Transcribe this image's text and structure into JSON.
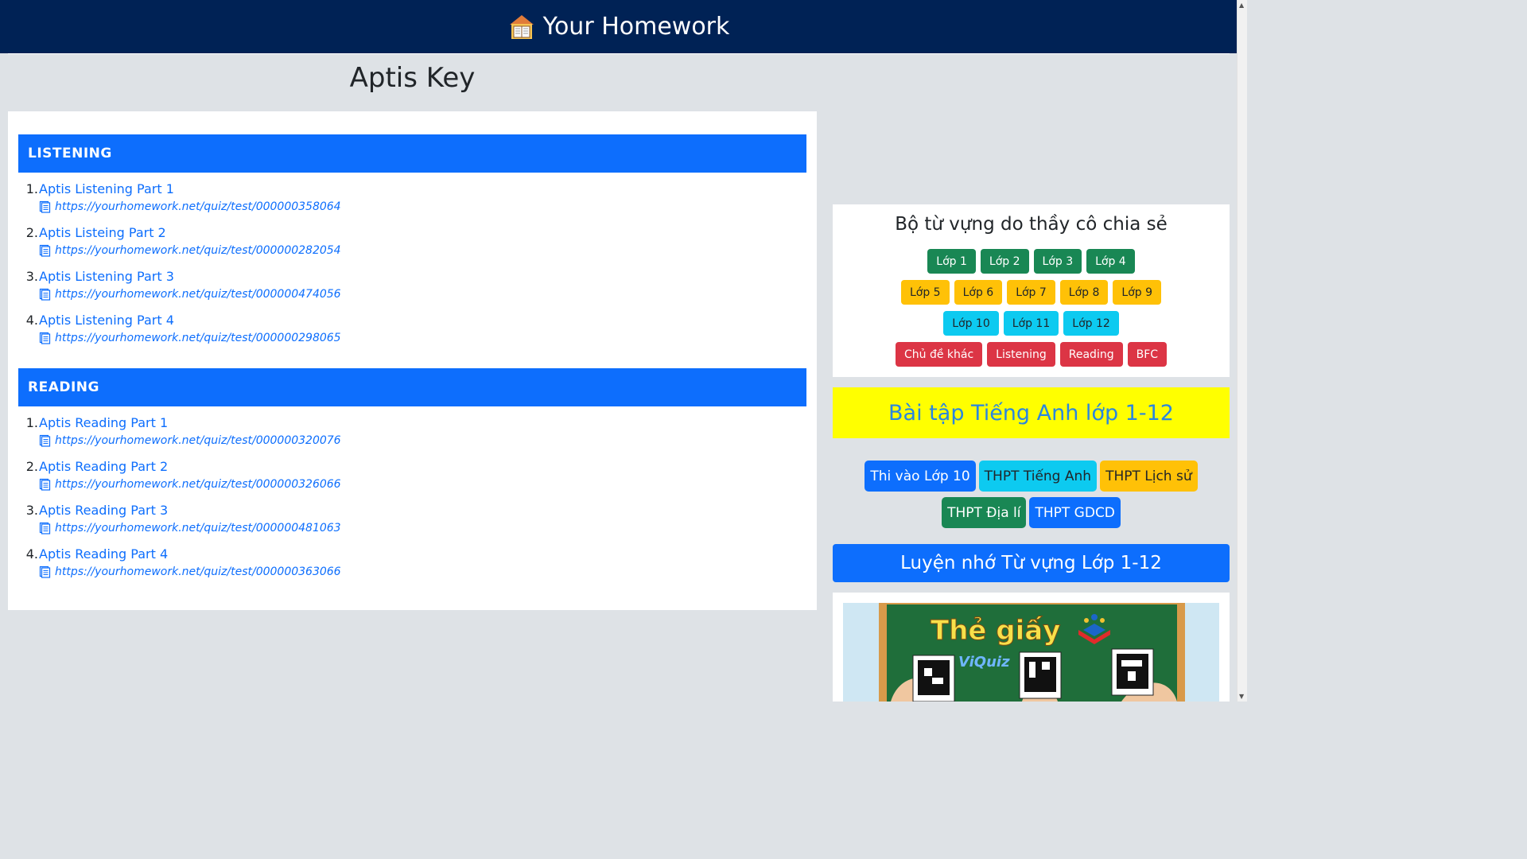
{
  "header": {
    "title": "Your Homework",
    "logo_icon": "house-book-icon"
  },
  "page": {
    "title": "Aptis Key"
  },
  "sections": [
    {
      "heading": "LISTENING",
      "items": [
        {
          "num": "1.",
          "title": "Aptis Listening Part 1",
          "url": "https://yourhomework.net/quiz/test/000000358064"
        },
        {
          "num": "2.",
          "title": "Aptis Listeing Part 2",
          "url": "https://yourhomework.net/quiz/test/000000282054"
        },
        {
          "num": "3.",
          "title": "Aptis Listening Part 3",
          "url": "https://yourhomework.net/quiz/test/000000474056"
        },
        {
          "num": "4.",
          "title": "Aptis Listening Part 4",
          "url": "https://yourhomework.net/quiz/test/000000298065"
        }
      ]
    },
    {
      "heading": "READING",
      "items": [
        {
          "num": "1.",
          "title": "Aptis Reading Part 1",
          "url": "https://yourhomework.net/quiz/test/000000320076"
        },
        {
          "num": "2.",
          "title": "Aptis Reading Part 2",
          "url": "https://yourhomework.net/quiz/test/000000326066"
        },
        {
          "num": "3.",
          "title": "Aptis Reading Part 3",
          "url": "https://yourhomework.net/quiz/test/000000481063"
        },
        {
          "num": "4.",
          "title": "Aptis Reading Part 4",
          "url": "https://yourhomework.net/quiz/test/000000363066"
        }
      ]
    }
  ],
  "vocab": {
    "title": "Bộ từ vựng do thầy cô chia sẻ",
    "rows": [
      [
        "Lớp 1",
        "Lớp 2",
        "Lớp 3",
        "Lớp 4"
      ],
      [
        "Lớp 5",
        "Lớp 6",
        "Lớp 7",
        "Lớp 8",
        "Lớp 9"
      ],
      [
        "Lớp 10",
        "Lớp 11",
        "Lớp 12"
      ],
      [
        "Chủ đề khác",
        "Listening",
        "Reading",
        "BFC"
      ]
    ]
  },
  "exercises_banner": "Bài tập Tiếng Anh lớp 1-12",
  "exam_buttons": {
    "row1": [
      "Thi vào Lớp 10",
      "THPT Tiếng Anh",
      "THPT Lịch sử"
    ],
    "row2": [
      "THPT Địa lí",
      "THPT GDCD"
    ]
  },
  "vocab_practice_banner": "Luyện nhớ Từ vựng Lớp 1-12",
  "promo": {
    "title": "Thẻ giấy",
    "brand": "ViQuiz"
  },
  "colors": {
    "header_bg": "#002255",
    "primary": "#0d6efd",
    "success": "#198754",
    "warning": "#ffc107",
    "info": "#0dcaf0",
    "danger": "#dc3545",
    "banner_yellow": "#ffff00"
  }
}
